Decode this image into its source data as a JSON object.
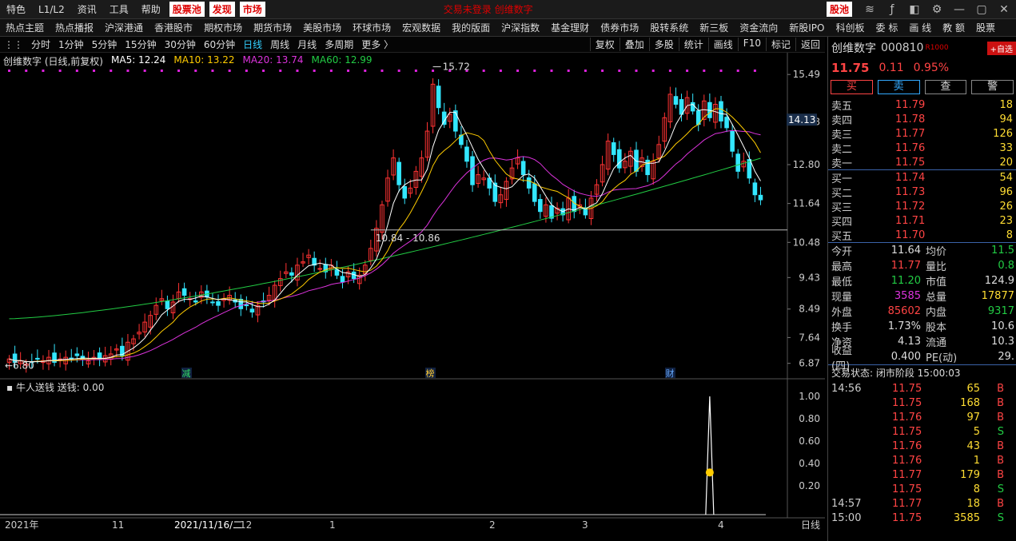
{
  "menubar": {
    "items": [
      "特色",
      "L1/L2",
      "资讯",
      "工具",
      "帮助"
    ],
    "highlights": [
      "股票池",
      "发现",
      "市场"
    ],
    "center_text": "交易未登录  创维数字",
    "right_badge": "股池"
  },
  "navbar": {
    "items": [
      "热点主题",
      "热点播报",
      "沪深港通",
      "香港股市",
      "期权市场",
      "期货市场",
      "美股市场",
      "环球市场",
      "宏观数据",
      "我的版面",
      "沪深指数",
      "基金理财",
      "债券市场",
      "股转系统",
      "新三板",
      "资金流向",
      "新股IPO",
      "科创板",
      "委 标",
      "画 线",
      "教 额",
      "股票"
    ]
  },
  "periodbar": {
    "periods": [
      "分时",
      "1分钟",
      "5分钟",
      "15分钟",
      "30分钟",
      "60分钟",
      "日线",
      "周线",
      "月线",
      "多周期",
      "更多 〉"
    ],
    "active": "日线",
    "tools": [
      "复权",
      "叠加",
      "多股",
      "统计",
      "画线",
      "F10",
      "标记",
      "返回"
    ]
  },
  "legend": {
    "title": "创维数字 (日线,前复权)",
    "ma5": "MA5: 12.24",
    "ma10": "MA10: 13.22",
    "ma20": "MA20: 13.74",
    "ma60": "MA60: 12.99",
    "colors": {
      "ma5": "#ffffff",
      "ma10": "#ffcc00",
      "ma20": "#dd33dd",
      "ma60": "#22cc44"
    }
  },
  "chart_data": {
    "type": "candlestick",
    "y_axis_labels": [
      "15.49",
      "14.08",
      "12.80",
      "11.64",
      "10.48",
      "9.43",
      "8.49",
      "7.64",
      "6.87"
    ],
    "current_price_label": "14.13",
    "high_annotation": "15.72",
    "low_annotation": "6.80",
    "range_annotation": "10.84 - 10.86",
    "event_markers": [
      "减",
      "榜",
      "财"
    ],
    "x_axis_labels": [
      "2021年",
      "11",
      "2021/11/16/二",
      "12",
      "1",
      "2",
      "3",
      "4"
    ],
    "axis_mode_label": "日线",
    "closes": [
      7.0,
      6.9,
      6.95,
      6.85,
      6.9,
      7.0,
      6.95,
      7.05,
      6.9,
      7.0,
      7.05,
      7.0,
      7.1,
      7.0,
      6.95,
      7.05,
      7.0,
      7.1,
      7.15,
      7.3,
      7.1,
      7.5,
      7.6,
      7.8,
      8.1,
      8.3,
      8.6,
      8.8,
      8.5,
      8.7,
      9.0,
      8.9,
      8.8,
      8.7,
      9.0,
      8.85,
      8.7,
      8.6,
      8.8,
      8.9,
      8.7,
      8.5,
      8.6,
      8.4,
      8.6,
      8.7,
      8.9,
      9.2,
      9.4,
      9.6,
      9.5,
      9.8,
      9.9,
      10.1,
      9.8,
      9.7,
      9.6,
      9.8,
      9.5,
      9.3,
      9.6,
      9.4,
      9.5,
      9.8,
      10.3,
      10.9,
      11.6,
      12.4,
      13.0,
      12.2,
      11.8,
      12.1,
      12.6,
      13.0,
      13.8,
      15.2,
      14.5,
      14.0,
      14.3,
      13.8,
      13.4,
      12.9,
      12.2,
      12.5,
      12.4,
      12.1,
      11.7,
      11.9,
      12.3,
      12.7,
      13.0,
      12.5,
      12.1,
      11.7,
      11.4,
      11.6,
      11.2,
      11.5,
      11.3,
      11.8,
      11.4,
      11.6,
      11.3,
      11.8,
      12.2,
      12.8,
      13.5,
      13.1,
      12.7,
      12.9,
      13.2,
      12.6,
      13.0,
      12.5,
      12.9,
      13.4,
      14.2,
      14.9,
      14.6,
      14.3,
      14.8,
      14.4,
      14.0,
      14.7,
      14.2,
      14.6,
      14.1,
      13.9,
      13.2,
      12.6,
      12.9,
      12.4,
      11.9,
      11.75
    ],
    "ma60_endpoints": {
      "start": 8.2,
      "end": 12.99
    },
    "indicator": {
      "name": "牛人送钱",
      "label": "送钱: 0.00",
      "y_axis_labels": [
        "1.00",
        "0.80",
        "0.60",
        "0.40",
        "0.20"
      ],
      "spike_index": 124,
      "spike_value": 1.0,
      "spike_icon": "money-bag-icon"
    }
  },
  "right_panel": {
    "name": "创维数字",
    "code": "000810",
    "level": "R1000",
    "add_button": "+自选",
    "price": "11.75",
    "change": "0.11",
    "change_pct": "0.95%",
    "action_buttons": [
      "买",
      "卖",
      "查",
      "警"
    ],
    "asks": [
      {
        "label": "卖五",
        "price": "11.79",
        "vol": "18"
      },
      {
        "label": "卖四",
        "price": "11.78",
        "vol": "94"
      },
      {
        "label": "卖三",
        "price": "11.77",
        "vol": "126"
      },
      {
        "label": "卖二",
        "price": "11.76",
        "vol": "33"
      },
      {
        "label": "卖一",
        "price": "11.75",
        "vol": "20"
      }
    ],
    "bids": [
      {
        "label": "买一",
        "price": "11.74",
        "vol": "54"
      },
      {
        "label": "买二",
        "price": "11.73",
        "vol": "96"
      },
      {
        "label": "买三",
        "price": "11.72",
        "vol": "26"
      },
      {
        "label": "买四",
        "price": "11.71",
        "vol": "23"
      },
      {
        "label": "买五",
        "price": "11.70",
        "vol": "8"
      }
    ],
    "stats": [
      {
        "k": "今开",
        "v": "11.64",
        "vc": "#dddddd",
        "k2": "均价",
        "v2": "11.5",
        "v2c": "#22cc44"
      },
      {
        "k": "最高",
        "v": "11.77",
        "vc": "#ff4444",
        "k2": "量比",
        "v2": "0.8",
        "v2c": "#22cc44"
      },
      {
        "k": "最低",
        "v": "11.20",
        "vc": "#22cc44",
        "k2": "市值",
        "v2": "124.9",
        "v2c": "#dddddd"
      },
      {
        "k": "现量",
        "v": "3585",
        "vc": "#dd33dd",
        "k2": "总量",
        "v2": "17877",
        "v2c": "#ffdd33"
      },
      {
        "k": "外盘",
        "v": "85602",
        "vc": "#ff4444",
        "k2": "内盘",
        "v2": "9317",
        "v2c": "#22cc44"
      },
      {
        "k": "换手",
        "v": "1.73%",
        "vc": "#dddddd",
        "k2": "股本",
        "v2": "10.6",
        "v2c": "#dddddd"
      },
      {
        "k": "净资",
        "v": "4.13",
        "vc": "#dddddd",
        "k2": "流通",
        "v2": "10.3",
        "v2c": "#dddddd"
      },
      {
        "k": "收益(四)",
        "v": "0.400",
        "vc": "#dddddd",
        "k2": "PE(动)",
        "v2": "29.",
        "v2c": "#dddddd"
      }
    ],
    "trade_status": "交易状态: 闭市阶段 15:00:03",
    "ticks": [
      {
        "t": "14:56",
        "p": "11.75",
        "v": "65",
        "d": "B"
      },
      {
        "t": "",
        "p": "11.75",
        "v": "168",
        "d": "B"
      },
      {
        "t": "",
        "p": "11.76",
        "v": "97",
        "d": "B"
      },
      {
        "t": "",
        "p": "11.75",
        "v": "5",
        "d": "S"
      },
      {
        "t": "",
        "p": "11.76",
        "v": "43",
        "d": "B"
      },
      {
        "t": "",
        "p": "11.76",
        "v": "1",
        "d": "B"
      },
      {
        "t": "",
        "p": "11.77",
        "v": "179",
        "d": "B"
      },
      {
        "t": "",
        "p": "11.75",
        "v": "8",
        "d": "S"
      },
      {
        "t": "14:57",
        "p": "11.77",
        "v": "18",
        "d": "B"
      },
      {
        "t": "15:00",
        "p": "11.75",
        "v": "3585",
        "d": "S"
      }
    ]
  }
}
